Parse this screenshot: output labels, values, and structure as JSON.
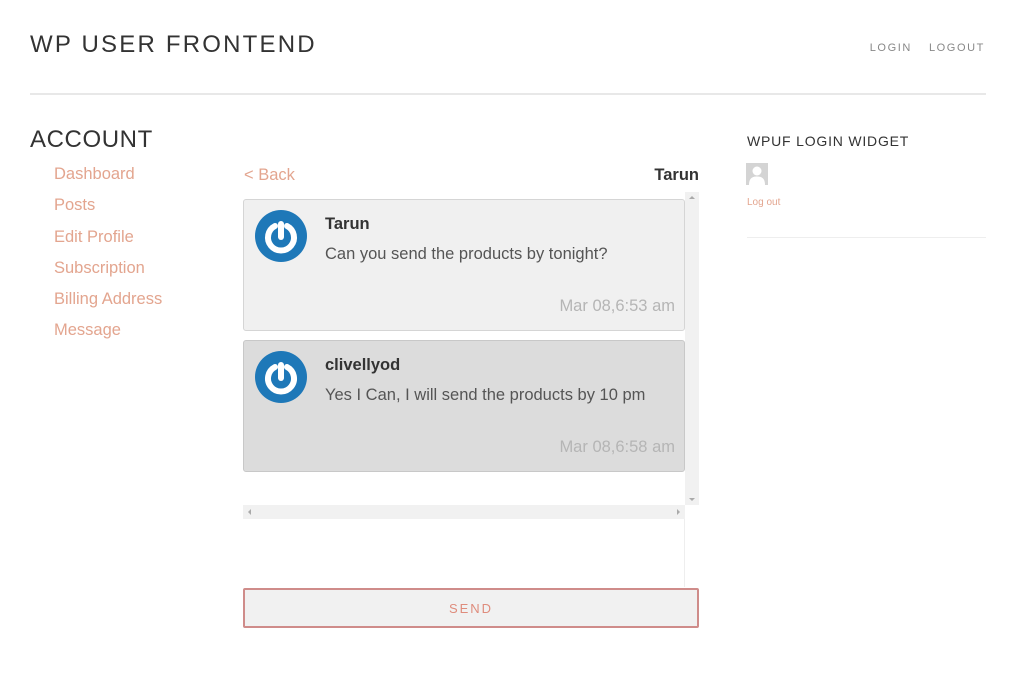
{
  "header": {
    "site_title": "WP USER FRONTEND",
    "nav": [
      {
        "label": "LOGIN"
      },
      {
        "label": "LOGOUT"
      }
    ]
  },
  "account": {
    "title": "ACCOUNT",
    "menu": [
      {
        "label": "Dashboard"
      },
      {
        "label": "Posts"
      },
      {
        "label": "Edit Profile"
      },
      {
        "label": "Subscription"
      },
      {
        "label": "Billing Address"
      },
      {
        "label": "Message"
      }
    ]
  },
  "conversation": {
    "back_label": "< Back",
    "with_user": "Tarun",
    "messages": [
      {
        "sender": "Tarun",
        "text": "Can you send the products by tonight?",
        "time": "Mar 08,6:53 am",
        "avatar_icon": "gravatar-power-icon"
      },
      {
        "sender": "clivellyod",
        "text": "Yes I Can, I will send the products by 10 pm",
        "time": "Mar 08,6:58 am",
        "avatar_icon": "gravatar-power-icon"
      }
    ],
    "reply_value": "",
    "send_label": "SEND"
  },
  "widget": {
    "title": "WPUF LOGIN WIDGET",
    "avatar_icon": "user-silhouette-icon",
    "logout_label": "Log out"
  },
  "colors": {
    "accent": "#e3a58f",
    "send_border": "#cf8c8a",
    "avatar_blue": "#1e78b8",
    "message_bg_incoming": "#f0f0f0",
    "message_bg_outgoing": "#dcdcdc"
  }
}
